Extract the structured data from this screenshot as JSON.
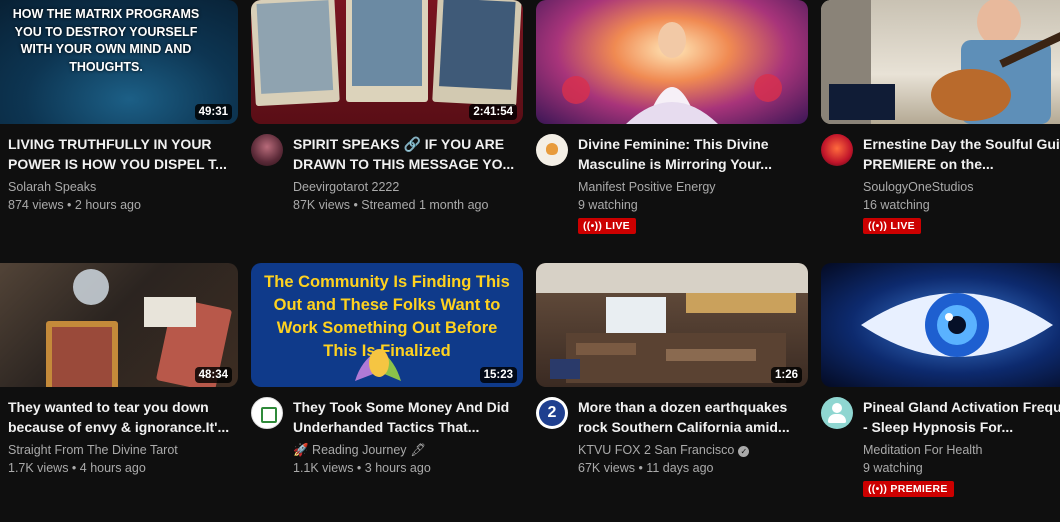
{
  "videos": [
    {
      "duration": "49:31",
      "thumb_text": "HOW THE MATRIX PROGRAMS YOU TO DESTROY YOURSELF WITH YOUR OWN MIND AND THOUGHTS.",
      "title": "LIVING TRUTHFULLY IN YOUR POWER IS HOW YOU DISPEL T...",
      "channel": "Solarah Speaks",
      "stats": "874 views • 2 hours ago"
    },
    {
      "duration": "2:41:54",
      "title": "SPIRIT SPEAKS 🔗 IF YOU ARE DRAWN TO THIS MESSAGE YO...",
      "channel": "Deevirgotarot 2222",
      "stats": "87K views • Streamed 1 month ago"
    },
    {
      "title": "Divine Feminine: This Divine Masculine is Mirroring Your...",
      "channel": "Manifest Positive Energy",
      "stats": "9 watching",
      "badge": "LIVE"
    },
    {
      "title": "Ernestine Day the Soulful Guitarist PREMIERE on the...",
      "channel": "SoulogyOneStudios",
      "stats": "16 watching",
      "badge": "LIVE"
    },
    {
      "duration": "48:34",
      "title": "They wanted to tear you down because of envy & ignorance.It'...",
      "channel": "Straight From The Divine Tarot",
      "stats": "1.7K views • 4 hours ago"
    },
    {
      "duration": "15:23",
      "thumb_text": "The Community Is Finding This Out and These Folks Want to Work Something Out Before This Is Finalized",
      "title": "They Took Some Money And Did Underhanded Tactics That...",
      "channel": "🚀 Reading Journey 🖋",
      "stats": "1.1K views • 3 hours ago"
    },
    {
      "duration": "1:26",
      "title": "More than a dozen earthquakes rock Southern California amid...",
      "channel": "KTVU FOX 2 San Francisco",
      "verified": "✓",
      "stats": "67K views • 11 days ago"
    },
    {
      "title": "Pineal Gland Activation Frequency - Sleep Hypnosis For...",
      "channel": "Meditation For Health",
      "stats": "9 watching",
      "badge": "PREMIERE"
    }
  ],
  "colors": {
    "background": "#0f0f0f",
    "live_badge": "#cc0000",
    "thumb_text_yellow": "#ffd21f"
  }
}
